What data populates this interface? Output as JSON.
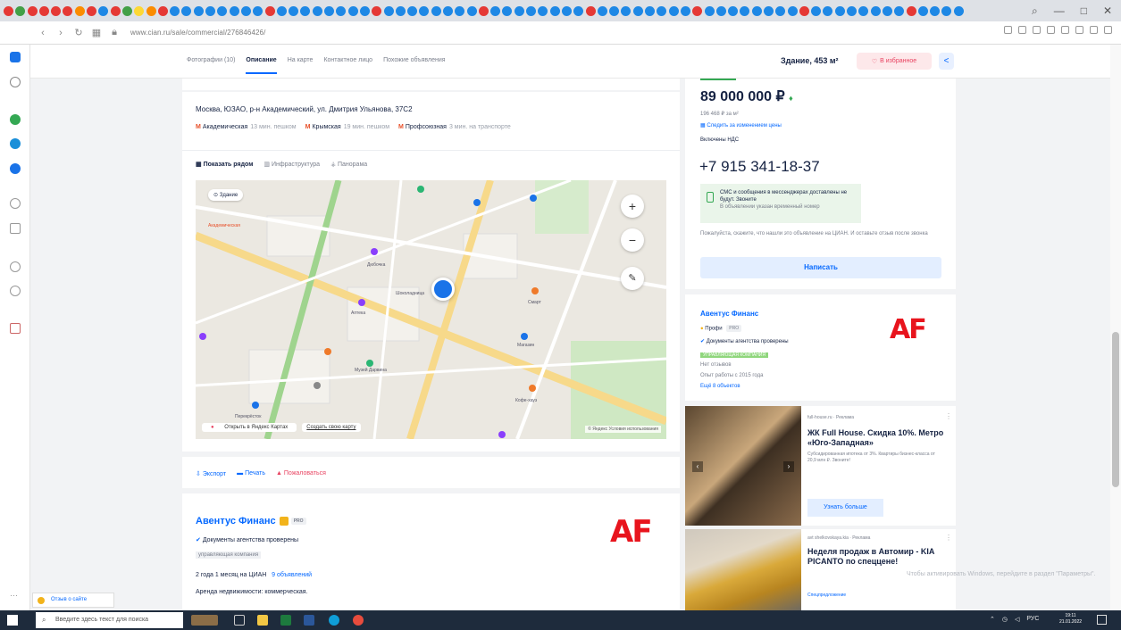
{
  "browser": {
    "url": "www.cian.ru/sale/commercial/276846426/",
    "window_controls": [
      "—",
      "□",
      "✕"
    ]
  },
  "site_nav": {
    "tabs": [
      "Фотографии (10)",
      "Описание",
      "На карте",
      "Контактное лицо",
      "Похожие объявления"
    ],
    "active_tab": "Описание",
    "area": "Здание, 453 м²",
    "favorite_label": "В избранное",
    "colors": {
      "accent": "#0468ff",
      "favorite": "#e84260"
    }
  },
  "location": {
    "address": "Москва, ЮЗАО, р-н Академический, ул. Дмитрия Ульянова, 37С2",
    "metro": [
      {
        "name": "Академическая",
        "time": "13 мин. пешком"
      },
      {
        "name": "Крымская",
        "time": "19 мин. пешком"
      },
      {
        "name": "Профсоюзная",
        "time": "3 мин. на транспорте"
      }
    ]
  },
  "map": {
    "tabs": [
      "Показать рядом",
      "Инфраструктура",
      "Панорама"
    ],
    "active_tab": "Показать рядом",
    "building_filter": "Здание",
    "open_in_yandex": "Открыть в Яндекс Картах",
    "create_map": "Создать свою карту",
    "terms": "© Яндекс Условия использования",
    "labels": [
      "Академическая",
      "Дюбочка",
      "Аптека",
      "Магазин",
      "Смарт",
      "Музей Дарвина",
      "Кофе-хауз",
      "Шоколадница",
      "Перекрёсток"
    ]
  },
  "actions": {
    "export": "Экспорт",
    "print": "Печать",
    "complain": "Пожаловаться"
  },
  "agency": {
    "name": "Авентус Финанс",
    "pro": "PRO",
    "verified": "Документы агентства проверены",
    "tag": "управляющая компания",
    "experience": "2 года 1 месяц на ЦИАН",
    "listings_link": "9 объявлений",
    "description": "Аренда недвижимости: коммерческая.",
    "logo_text": "AF"
  },
  "offer": {
    "price": "89 000 000 ₽",
    "price_per_m2": "196 468 ₽ за м²",
    "subscribe": "Следить за изменением цены",
    "vat": "Включены НДС",
    "phone": "+7 915 341-18-37",
    "sms_title": "СМС и сообщения в мессенджерах доставлены не будут. Звоните",
    "sms_sub": "В объявлении указан временный номер",
    "notice": "Пожалуйста, скажите, что нашли это объявление на ЦИАН. И оставьте отзыв после звонка",
    "write_button": "Написать"
  },
  "agent_card": {
    "name": "Авентус Финанс",
    "profi": "Профи",
    "pro": "PRO",
    "verified": "Документы агентства проверены",
    "tag": "УПРАВЛЯЮЩАЯ КОМПАНИЯ",
    "no_reviews": "Нет отзывов",
    "since": "Опыт работы с 2015 года",
    "more_objects": "Ещё 8 объектов",
    "logo_text": "AF"
  },
  "ads": [
    {
      "source": "full-house.ru · Реклама",
      "title": "ЖК Full House. Скидка 10%. Метро «Юго-Западная»",
      "text": "Субсидированная ипотека от 3%. Квартиры бизнес-класса от 20,9 млн ₽. Звоните!",
      "button": "Узнать больше"
    },
    {
      "source": "avt shelkovskaya.kia · Реклама",
      "title": "Неделя продаж в Автомир - KIA PICANTO по спеццене!",
      "text": "Спецпредложение"
    }
  ],
  "feedback_label": "Отзыв о сайте",
  "watermark": "Чтобы активировать Windows, перейдите в раздел \"Параметры\".",
  "taskbar": {
    "search_placeholder": "Введите здесь текст для поиска",
    "lang": "РУС",
    "time": "19:11",
    "date": "21.01.2022"
  }
}
